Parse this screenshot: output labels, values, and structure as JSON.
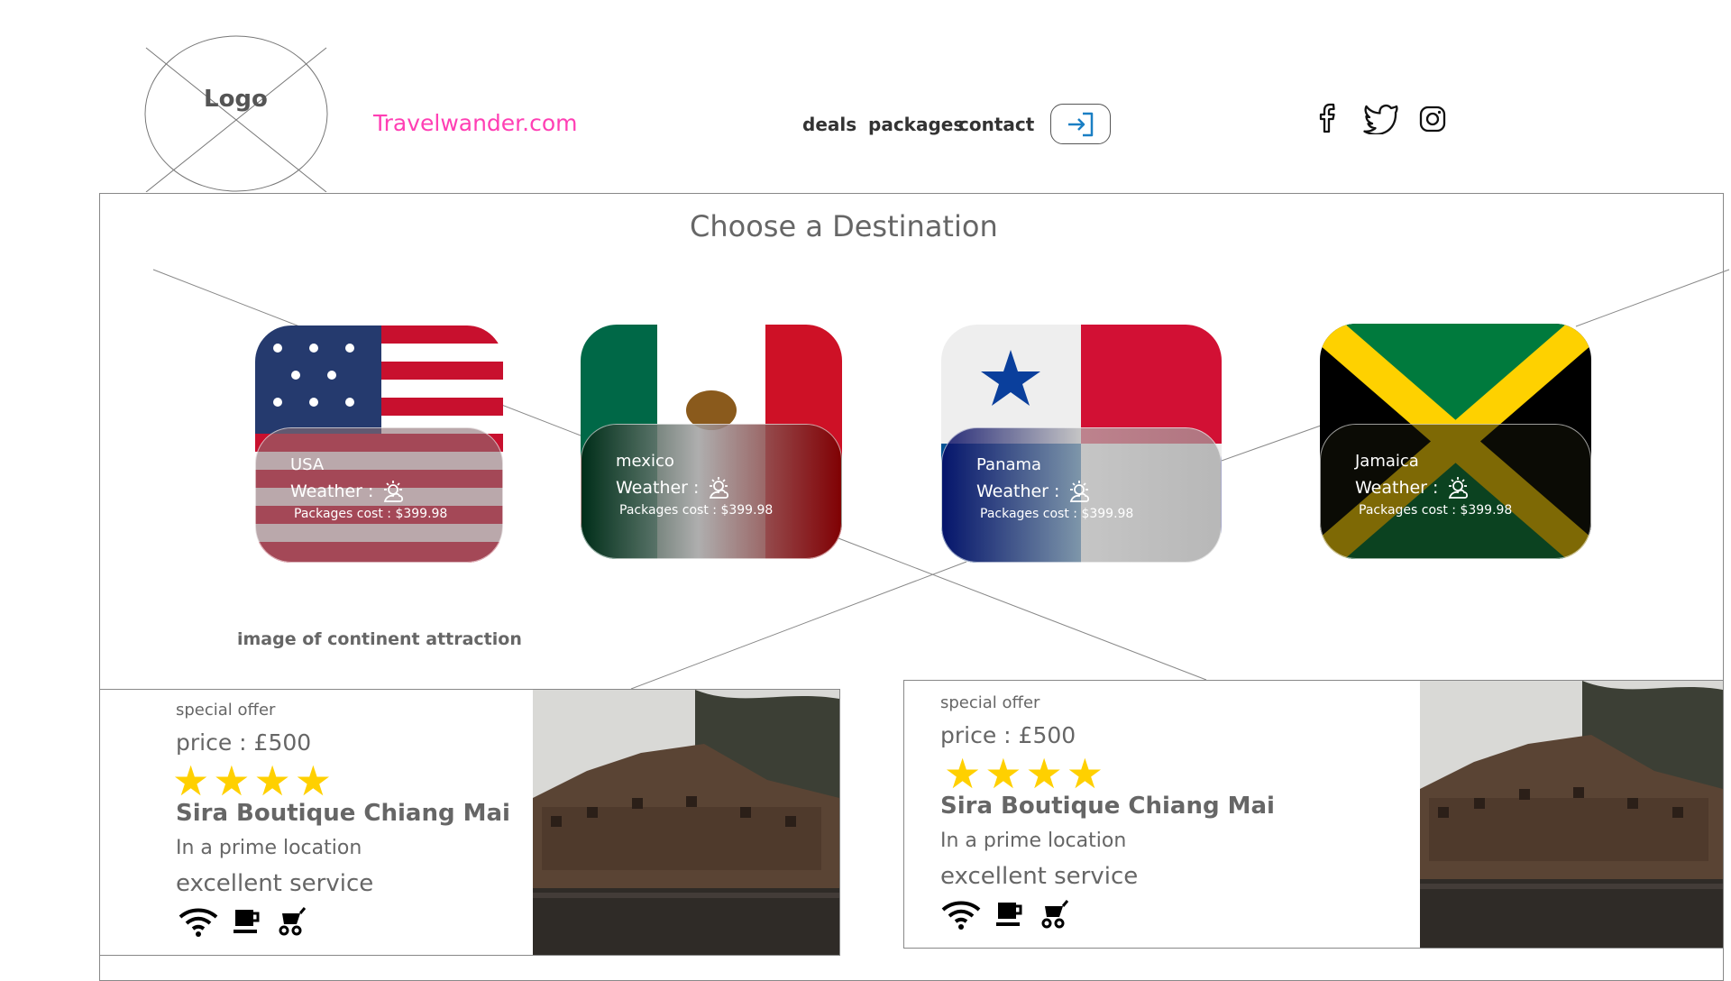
{
  "header": {
    "logo_label": "Logo",
    "brand": "Travelwander.com",
    "brand_color": "#ff3fb4",
    "nav": [
      "deals",
      "packages",
      "contact"
    ],
    "login_icon": "login-icon",
    "social_icons": [
      "facebook-icon",
      "twitter-icon",
      "instagram-icon"
    ]
  },
  "main": {
    "title": "Choose a Destination",
    "attraction_caption": "image of continent attraction"
  },
  "destinations": [
    {
      "name": "USA",
      "weather_label": "Weather :",
      "cost": "Packages cost : $399.98"
    },
    {
      "name": "mexico",
      "weather_label": "Weather :",
      "cost": "Packages cost : $399.98"
    },
    {
      "name": "Panama",
      "weather_label": "Weather :",
      "cost": "Packages cost : $399.98"
    },
    {
      "name": "Jamaica",
      "weather_label": "Weather :",
      "cost": "Packages cost : $399.98"
    }
  ],
  "offers": [
    {
      "tag": "special offer",
      "price": "price : £500",
      "stars": 4,
      "stars_text": "★★★★",
      "hotel": "Sira Boutique Chiang Mai",
      "location": "In a prime location",
      "service": "excellent service",
      "amenities": [
        "wifi-icon",
        "coffee-icon",
        "stroller-icon"
      ]
    },
    {
      "tag": "special offer",
      "price": "price : £500",
      "stars": 4,
      "stars_text": "★★★★",
      "hotel": "Sira Boutique Chiang Mai",
      "location": "In a prime location",
      "service": "excellent service",
      "amenities": [
        "wifi-icon",
        "coffee-icon",
        "stroller-icon"
      ]
    }
  ],
  "colors": {
    "star": "#ffd000",
    "border": "#888888",
    "text": "#666666"
  }
}
